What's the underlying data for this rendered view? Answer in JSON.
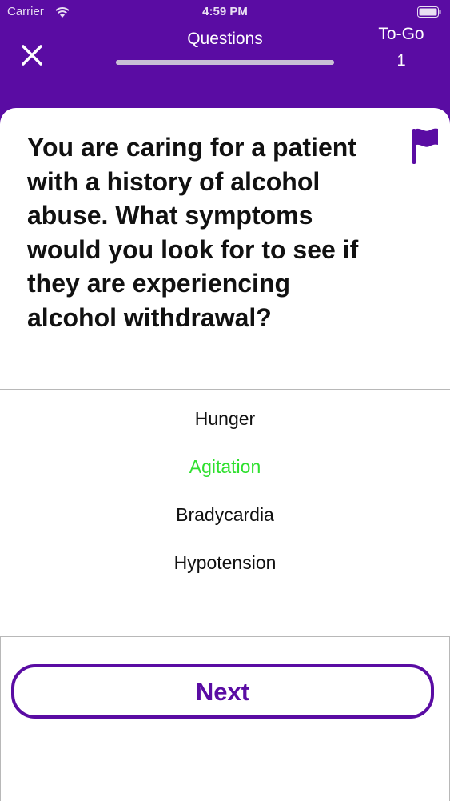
{
  "status_bar": {
    "carrier": "Carrier",
    "time": "4:59 PM",
    "icons": [
      "wifi-icon",
      "battery-icon"
    ]
  },
  "header": {
    "close_icon": "close-icon",
    "title": "Questions",
    "progress": 1.0,
    "togo_label": "To-Go",
    "togo_count": "1"
  },
  "question": {
    "text": "You are caring for a patient with a history of alcohol abuse. What symptoms would you look for to see if they are experiencing alcohol withdrawal?",
    "flag_icon": "flag-icon"
  },
  "answers": [
    {
      "label": "Hunger",
      "state": "default"
    },
    {
      "label": "Agitation",
      "state": "correct"
    },
    {
      "label": "Bradycardia",
      "state": "default"
    },
    {
      "label": "Hypotension",
      "state": "default"
    }
  ],
  "footer": {
    "next_label": "Next"
  },
  "colors": {
    "brand": "#5a0ca3",
    "correct": "#2fe02f",
    "text": "#111111"
  }
}
